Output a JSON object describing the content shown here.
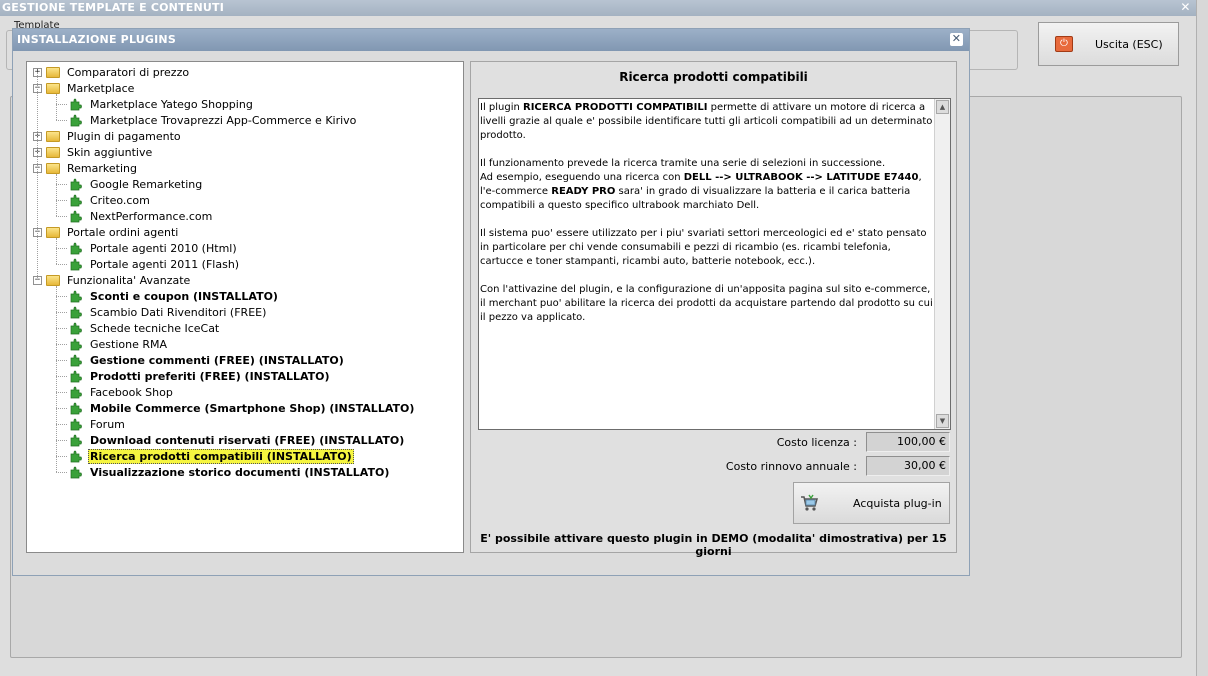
{
  "outer_window": {
    "title": "GESTIONE TEMPLATE E CONTENUTI",
    "close_glyph": "✕",
    "sublabel": "Template",
    "exit_button": {
      "label": "Uscita (ESC)",
      "icon": "power-icon"
    }
  },
  "dialog": {
    "title": "INSTALLAZIONE PLUGINS",
    "close_glyph": "✕"
  },
  "tree": {
    "items": [
      {
        "label": "Comparatori di prezzo",
        "type": "folder",
        "expander": "+",
        "bold": false
      },
      {
        "label": "Marketplace",
        "type": "folder",
        "expander": "−",
        "bold": false
      },
      {
        "label": "Marketplace Yatego Shopping",
        "type": "plugin",
        "bold": false
      },
      {
        "label": "Marketplace Trovaprezzi App-Commerce e Kirivo",
        "type": "plugin",
        "bold": false
      },
      {
        "label": "Plugin di pagamento",
        "type": "folder",
        "expander": "+",
        "bold": false
      },
      {
        "label": "Skin aggiuntive",
        "type": "folder",
        "expander": "+",
        "bold": false
      },
      {
        "label": "Remarketing",
        "type": "folder",
        "expander": "−",
        "bold": false
      },
      {
        "label": "Google Remarketing",
        "type": "plugin",
        "bold": false
      },
      {
        "label": "Criteo.com",
        "type": "plugin",
        "bold": false
      },
      {
        "label": "NextPerformance.com",
        "type": "plugin",
        "bold": false
      },
      {
        "label": "Portale ordini agenti",
        "type": "folder",
        "expander": "−",
        "bold": false
      },
      {
        "label": "Portale agenti 2010 (Html)",
        "type": "plugin",
        "bold": false
      },
      {
        "label": "Portale agenti 2011 (Flash)",
        "type": "plugin",
        "bold": false
      },
      {
        "label": "Funzionalita' Avanzate",
        "type": "folder",
        "expander": "−",
        "bold": false
      },
      {
        "label": "Sconti e coupon (INSTALLATO)",
        "type": "plugin",
        "bold": true
      },
      {
        "label": "Scambio Dati Rivenditori (FREE)",
        "type": "plugin",
        "bold": false
      },
      {
        "label": "Schede tecniche IceCat",
        "type": "plugin",
        "bold": false
      },
      {
        "label": "Gestione RMA",
        "type": "plugin",
        "bold": false
      },
      {
        "label": "Gestione commenti (FREE) (INSTALLATO)",
        "type": "plugin",
        "bold": true
      },
      {
        "label": "Prodotti preferiti (FREE) (INSTALLATO)",
        "type": "plugin",
        "bold": true
      },
      {
        "label": "Facebook Shop",
        "type": "plugin",
        "bold": false
      },
      {
        "label": "Mobile Commerce (Smartphone Shop) (INSTALLATO)",
        "type": "plugin",
        "bold": true
      },
      {
        "label": "Forum",
        "type": "plugin",
        "bold": false
      },
      {
        "label": "Download contenuti riservati (FREE) (INSTALLATO)",
        "type": "plugin",
        "bold": true
      },
      {
        "label": "Ricerca prodotti compatibili (INSTALLATO)",
        "type": "plugin",
        "bold": true,
        "selected": true
      },
      {
        "label": "Visualizzazione storico documenti (INSTALLATO)",
        "type": "plugin",
        "bold": true
      }
    ]
  },
  "detail": {
    "title": "Ricerca prodotti compatibili",
    "description_html": "Il plugin <b>RICERCA PRODOTTI COMPATIBILI</b> permette di attivare un motore di ricerca a livelli grazie al quale e' possibile identificare tutti gli articoli compatibili ad un determinato prodotto.<br><br>Il funzionamento prevede la ricerca tramite una serie di selezioni in successione.<br>Ad esempio, eseguendo una ricerca con <b>DELL --&gt; ULTRABOOK --&gt; LATITUDE E7440</b>, l'e-commerce <b>READY PRO</b> sara' in grado di visualizzare la batteria e il carica batteria compatibili a questo specifico ultrabook marchiato Dell.<br><br>Il sistema puo' essere utilizzato per i piu' svariati settori merceologici ed e' stato pensato in particolare per chi vende consumabili e pezzi di ricambio (es. ricambi telefonia, cartucce e toner stampanti, ricambi auto, batterie notebook, ecc.).<br><br>Con l'attivazine del plugin, e la configurazione di un'apposita pagina sul sito e-commerce, il merchant puo' abilitare la ricerca dei prodotti da acquistare partendo dal prodotto su cui il pezzo va applicato.",
    "license_label": "Costo licenza :",
    "license_value": "100,00 €",
    "renewal_label": "Costo rinnovo annuale :",
    "renewal_value": "30,00 €",
    "buy_button": "Acquista plug-in",
    "demo_note": "E' possibile attivare questo plugin in DEMO (modalita' dimostrativa) per 15 giorni"
  },
  "colors": {
    "selection": "#f5f540",
    "dialog_title": "#8ea1b6",
    "puzzle_green": "#3aa13a"
  }
}
